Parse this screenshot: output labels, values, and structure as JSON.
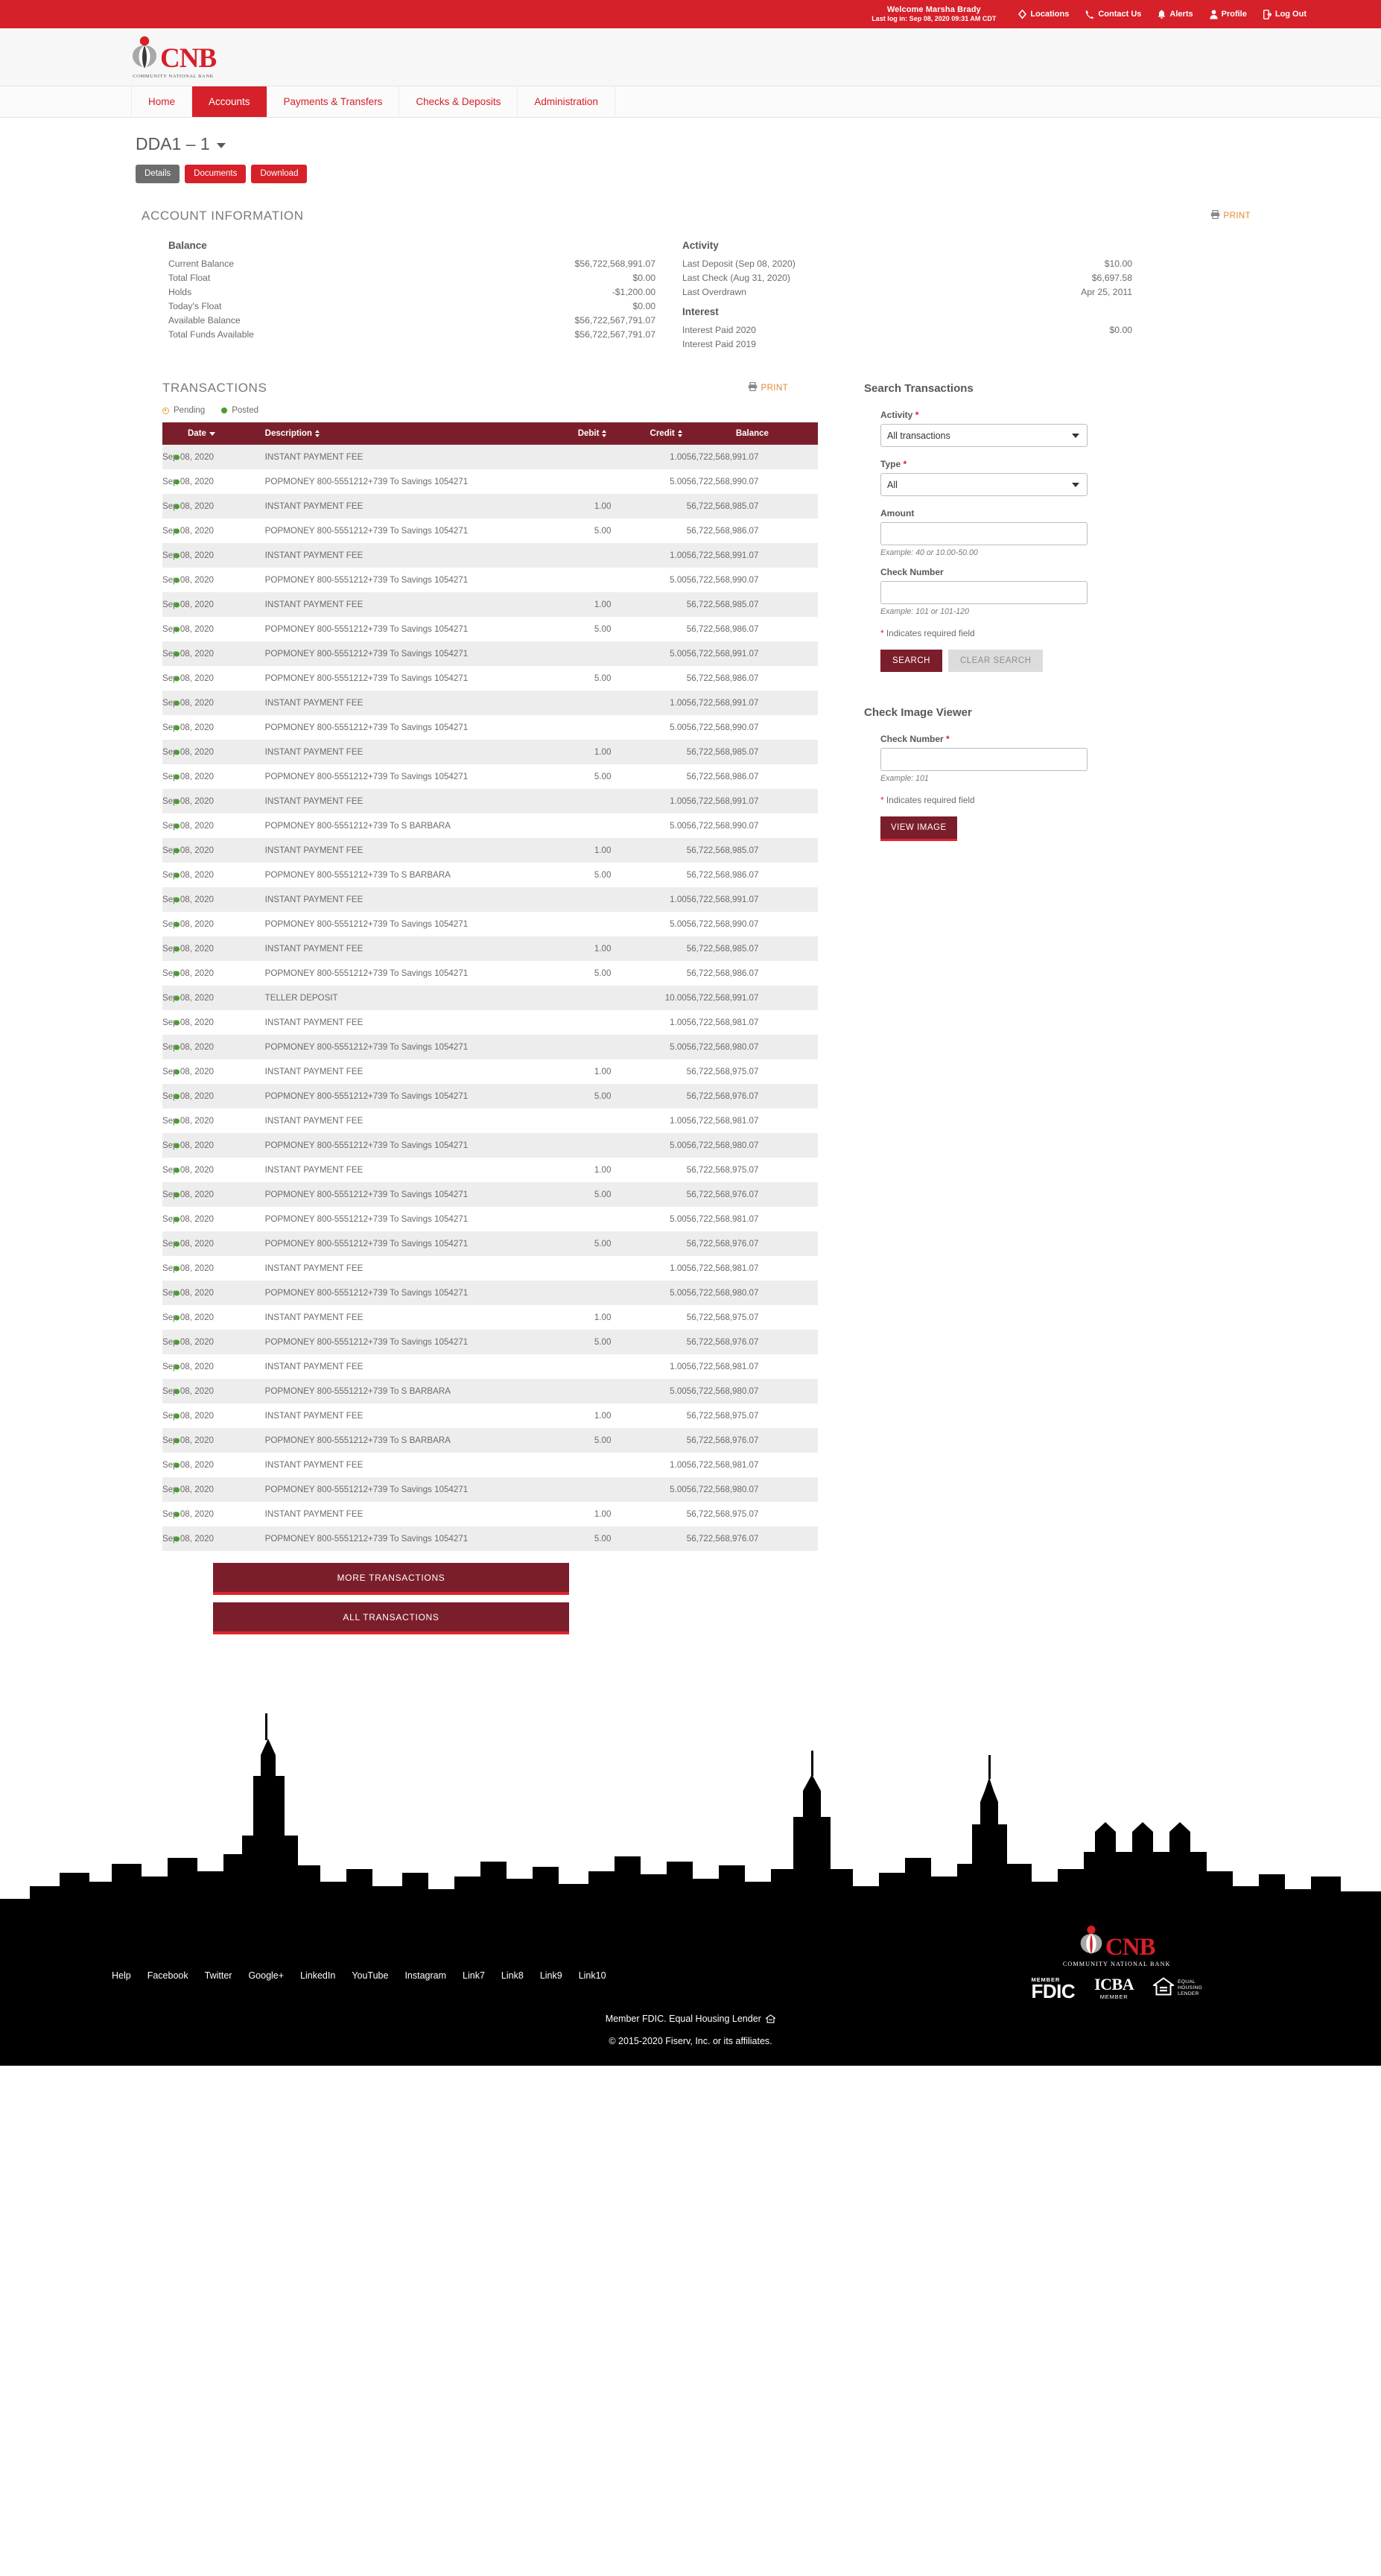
{
  "brand": {
    "logo_text": "CNB",
    "logo_subtitle": "COMMUNITY NATIONAL BANK",
    "accent_red": "#d6202a",
    "dark_red": "#7b1e2b",
    "orange": "#e08a2e",
    "posted_green": "#4a9c2d"
  },
  "utility_bar": {
    "welcome": "Welcome Marsha Brady",
    "last_login": "Last log in: Sep 08, 2020 09:31 AM CDT",
    "links": [
      {
        "label": "Locations",
        "icon": "location-pin-icon"
      },
      {
        "label": "Contact Us",
        "icon": "phone-icon"
      },
      {
        "label": "Alerts",
        "icon": "bell-icon"
      },
      {
        "label": "Profile",
        "icon": "person-icon"
      },
      {
        "label": "Log Out",
        "icon": "logout-icon"
      }
    ]
  },
  "nav": {
    "items": [
      {
        "label": "Home",
        "active": false
      },
      {
        "label": "Accounts",
        "active": true
      },
      {
        "label": "Payments & Transfers",
        "active": false
      },
      {
        "label": "Checks & Deposits",
        "active": false
      },
      {
        "label": "Administration",
        "active": false
      }
    ]
  },
  "account": {
    "title": "DDA1 – 1",
    "buttons": [
      {
        "label": "Details",
        "style": "grey"
      },
      {
        "label": "Documents",
        "style": "red"
      },
      {
        "label": "Download",
        "style": "red"
      }
    ]
  },
  "account_information": {
    "heading": "ACCOUNT INFORMATION",
    "print_label": "PRINT",
    "balance": {
      "heading": "Balance",
      "rows": [
        {
          "label": "Current Balance",
          "value": "$56,722,568,991.07"
        },
        {
          "label": "Total Float",
          "value": "$0.00"
        },
        {
          "label": "Holds",
          "value": "-$1,200.00"
        },
        {
          "label": "Today's Float",
          "value": "$0.00"
        },
        {
          "label": "Available Balance",
          "value": "$56,722,567,791.07"
        },
        {
          "label": "Total Funds Available",
          "value": "$56,722,567,791.07"
        }
      ]
    },
    "activity": {
      "heading": "Activity",
      "rows": [
        {
          "label": "Last Deposit (Sep 08, 2020)",
          "value": "$10.00"
        },
        {
          "label": "Last Check (Aug 31, 2020)",
          "value": "$6,697.58"
        },
        {
          "label": "Last Overdrawn",
          "value": "Apr 25, 2011"
        }
      ]
    },
    "interest": {
      "heading": "Interest",
      "rows": [
        {
          "label": "Interest Paid 2020",
          "value": "$0.00"
        },
        {
          "label": "Interest Paid 2019",
          "value": ""
        }
      ]
    }
  },
  "transactions": {
    "heading": "TRANSACTIONS",
    "print_label": "PRINT",
    "legend": [
      {
        "label": "Pending",
        "icon": "pending-clock-icon"
      },
      {
        "label": "Posted",
        "icon": "posted-dot-icon"
      }
    ],
    "columns": [
      {
        "key": "date",
        "label": "Date",
        "sort": "desc"
      },
      {
        "key": "description",
        "label": "Description",
        "sort": "both"
      },
      {
        "key": "debit",
        "label": "Debit",
        "sort": "both"
      },
      {
        "key": "credit",
        "label": "Credit",
        "sort": "both"
      },
      {
        "key": "balance",
        "label": "Balance",
        "sort": "none"
      }
    ],
    "rows": [
      {
        "status": "posted",
        "date": "Sep 08, 2020",
        "description": "INSTANT PAYMENT FEE",
        "debit": "",
        "credit": "1.00",
        "balance": "56,722,568,991.07"
      },
      {
        "status": "posted",
        "date": "Sep 08, 2020",
        "description": "POPMONEY 800-5551212+739 To Savings 1054271",
        "debit": "",
        "credit": "5.00",
        "balance": "56,722,568,990.07"
      },
      {
        "status": "posted",
        "date": "Sep 08, 2020",
        "description": "INSTANT PAYMENT FEE",
        "debit": "1.00",
        "credit": "",
        "balance": "56,722,568,985.07"
      },
      {
        "status": "posted",
        "date": "Sep 08, 2020",
        "description": "POPMONEY 800-5551212+739 To Savings 1054271",
        "debit": "5.00",
        "credit": "",
        "balance": "56,722,568,986.07"
      },
      {
        "status": "posted",
        "date": "Sep 08, 2020",
        "description": "INSTANT PAYMENT FEE",
        "debit": "",
        "credit": "1.00",
        "balance": "56,722,568,991.07"
      },
      {
        "status": "posted",
        "date": "Sep 08, 2020",
        "description": "POPMONEY 800-5551212+739 To Savings 1054271",
        "debit": "",
        "credit": "5.00",
        "balance": "56,722,568,990.07"
      },
      {
        "status": "posted",
        "date": "Sep 08, 2020",
        "description": "INSTANT PAYMENT FEE",
        "debit": "1.00",
        "credit": "",
        "balance": "56,722,568,985.07"
      },
      {
        "status": "posted",
        "date": "Sep 08, 2020",
        "description": "POPMONEY 800-5551212+739 To Savings 1054271",
        "debit": "5.00",
        "credit": "",
        "balance": "56,722,568,986.07"
      },
      {
        "status": "posted",
        "date": "Sep 08, 2020",
        "description": "POPMONEY 800-5551212+739 To Savings 1054271",
        "debit": "",
        "credit": "5.00",
        "balance": "56,722,568,991.07"
      },
      {
        "status": "posted",
        "date": "Sep 08, 2020",
        "description": "POPMONEY 800-5551212+739 To Savings 1054271",
        "debit": "5.00",
        "credit": "",
        "balance": "56,722,568,986.07"
      },
      {
        "status": "posted",
        "date": "Sep 08, 2020",
        "description": "INSTANT PAYMENT FEE",
        "debit": "",
        "credit": "1.00",
        "balance": "56,722,568,991.07"
      },
      {
        "status": "posted",
        "date": "Sep 08, 2020",
        "description": "POPMONEY 800-5551212+739 To Savings 1054271",
        "debit": "",
        "credit": "5.00",
        "balance": "56,722,568,990.07"
      },
      {
        "status": "posted",
        "date": "Sep 08, 2020",
        "description": "INSTANT PAYMENT FEE",
        "debit": "1.00",
        "credit": "",
        "balance": "56,722,568,985.07"
      },
      {
        "status": "posted",
        "date": "Sep 08, 2020",
        "description": "POPMONEY 800-5551212+739 To Savings 1054271",
        "debit": "5.00",
        "credit": "",
        "balance": "56,722,568,986.07"
      },
      {
        "status": "posted",
        "date": "Sep 08, 2020",
        "description": "INSTANT PAYMENT FEE",
        "debit": "",
        "credit": "1.00",
        "balance": "56,722,568,991.07"
      },
      {
        "status": "posted",
        "date": "Sep 08, 2020",
        "description": "POPMONEY 800-5551212+739 To S BARBARA",
        "debit": "",
        "credit": "5.00",
        "balance": "56,722,568,990.07"
      },
      {
        "status": "posted",
        "date": "Sep 08, 2020",
        "description": "INSTANT PAYMENT FEE",
        "debit": "1.00",
        "credit": "",
        "balance": "56,722,568,985.07"
      },
      {
        "status": "posted",
        "date": "Sep 08, 2020",
        "description": "POPMONEY 800-5551212+739 To S BARBARA",
        "debit": "5.00",
        "credit": "",
        "balance": "56,722,568,986.07"
      },
      {
        "status": "posted",
        "date": "Sep 08, 2020",
        "description": "INSTANT PAYMENT FEE",
        "debit": "",
        "credit": "1.00",
        "balance": "56,722,568,991.07"
      },
      {
        "status": "posted",
        "date": "Sep 08, 2020",
        "description": "POPMONEY 800-5551212+739 To Savings 1054271",
        "debit": "",
        "credit": "5.00",
        "balance": "56,722,568,990.07"
      },
      {
        "status": "posted",
        "date": "Sep 08, 2020",
        "description": "INSTANT PAYMENT FEE",
        "debit": "1.00",
        "credit": "",
        "balance": "56,722,568,985.07"
      },
      {
        "status": "posted",
        "date": "Sep 08, 2020",
        "description": "POPMONEY 800-5551212+739 To Savings 1054271",
        "debit": "5.00",
        "credit": "",
        "balance": "56,722,568,986.07"
      },
      {
        "status": "posted",
        "date": "Sep 08, 2020",
        "description": "TELLER DEPOSIT",
        "debit": "",
        "credit": "10.00",
        "balance": "56,722,568,991.07"
      },
      {
        "status": "posted",
        "date": "Sep 08, 2020",
        "description": "INSTANT PAYMENT FEE",
        "debit": "",
        "credit": "1.00",
        "balance": "56,722,568,981.07"
      },
      {
        "status": "posted",
        "date": "Sep 08, 2020",
        "description": "POPMONEY 800-5551212+739 To Savings 1054271",
        "debit": "",
        "credit": "5.00",
        "balance": "56,722,568,980.07"
      },
      {
        "status": "posted",
        "date": "Sep 08, 2020",
        "description": "INSTANT PAYMENT FEE",
        "debit": "1.00",
        "credit": "",
        "balance": "56,722,568,975.07"
      },
      {
        "status": "posted",
        "date": "Sep 08, 2020",
        "description": "POPMONEY 800-5551212+739 To Savings 1054271",
        "debit": "5.00",
        "credit": "",
        "balance": "56,722,568,976.07"
      },
      {
        "status": "posted",
        "date": "Sep 08, 2020",
        "description": "INSTANT PAYMENT FEE",
        "debit": "",
        "credit": "1.00",
        "balance": "56,722,568,981.07"
      },
      {
        "status": "posted",
        "date": "Sep 08, 2020",
        "description": "POPMONEY 800-5551212+739 To Savings 1054271",
        "debit": "",
        "credit": "5.00",
        "balance": "56,722,568,980.07"
      },
      {
        "status": "posted",
        "date": "Sep 08, 2020",
        "description": "INSTANT PAYMENT FEE",
        "debit": "1.00",
        "credit": "",
        "balance": "56,722,568,975.07"
      },
      {
        "status": "posted",
        "date": "Sep 08, 2020",
        "description": "POPMONEY 800-5551212+739 To Savings 1054271",
        "debit": "5.00",
        "credit": "",
        "balance": "56,722,568,976.07"
      },
      {
        "status": "posted",
        "date": "Sep 08, 2020",
        "description": "POPMONEY 800-5551212+739 To Savings 1054271",
        "debit": "",
        "credit": "5.00",
        "balance": "56,722,568,981.07"
      },
      {
        "status": "posted",
        "date": "Sep 08, 2020",
        "description": "POPMONEY 800-5551212+739 To Savings 1054271",
        "debit": "5.00",
        "credit": "",
        "balance": "56,722,568,976.07"
      },
      {
        "status": "posted",
        "date": "Sep 08, 2020",
        "description": "INSTANT PAYMENT FEE",
        "debit": "",
        "credit": "1.00",
        "balance": "56,722,568,981.07"
      },
      {
        "status": "posted",
        "date": "Sep 08, 2020",
        "description": "POPMONEY 800-5551212+739 To Savings 1054271",
        "debit": "",
        "credit": "5.00",
        "balance": "56,722,568,980.07"
      },
      {
        "status": "posted",
        "date": "Sep 08, 2020",
        "description": "INSTANT PAYMENT FEE",
        "debit": "1.00",
        "credit": "",
        "balance": "56,722,568,975.07"
      },
      {
        "status": "posted",
        "date": "Sep 08, 2020",
        "description": "POPMONEY 800-5551212+739 To Savings 1054271",
        "debit": "5.00",
        "credit": "",
        "balance": "56,722,568,976.07"
      },
      {
        "status": "posted",
        "date": "Sep 08, 2020",
        "description": "INSTANT PAYMENT FEE",
        "debit": "",
        "credit": "1.00",
        "balance": "56,722,568,981.07"
      },
      {
        "status": "posted",
        "date": "Sep 08, 2020",
        "description": "POPMONEY 800-5551212+739 To S BARBARA",
        "debit": "",
        "credit": "5.00",
        "balance": "56,722,568,980.07"
      },
      {
        "status": "posted",
        "date": "Sep 08, 2020",
        "description": "INSTANT PAYMENT FEE",
        "debit": "1.00",
        "credit": "",
        "balance": "56,722,568,975.07"
      },
      {
        "status": "posted",
        "date": "Sep 08, 2020",
        "description": "POPMONEY 800-5551212+739 To S BARBARA",
        "debit": "5.00",
        "credit": "",
        "balance": "56,722,568,976.07"
      },
      {
        "status": "posted",
        "date": "Sep 08, 2020",
        "description": "INSTANT PAYMENT FEE",
        "debit": "",
        "credit": "1.00",
        "balance": "56,722,568,981.07"
      },
      {
        "status": "posted",
        "date": "Sep 08, 2020",
        "description": "POPMONEY 800-5551212+739 To Savings 1054271",
        "debit": "",
        "credit": "5.00",
        "balance": "56,722,568,980.07"
      },
      {
        "status": "posted",
        "date": "Sep 08, 2020",
        "description": "INSTANT PAYMENT FEE",
        "debit": "1.00",
        "credit": "",
        "balance": "56,722,568,975.07"
      },
      {
        "status": "posted",
        "date": "Sep 08, 2020",
        "description": "POPMONEY 800-5551212+739 To Savings 1054271",
        "debit": "5.00",
        "credit": "",
        "balance": "56,722,568,976.07"
      }
    ],
    "more_button": "MORE TRANSACTIONS",
    "all_button": "ALL TRANSACTIONS"
  },
  "search_panel": {
    "title": "Search Transactions",
    "activity_label": "Activity",
    "activity_value": "All transactions",
    "activity_options": [
      "All transactions"
    ],
    "type_label": "Type",
    "type_value": "All",
    "type_options": [
      "All"
    ],
    "amount_label": "Amount",
    "amount_value": "",
    "amount_hint": "Example: 40 or 10.00-50.00",
    "check_number_label": "Check Number",
    "check_number_value": "",
    "check_number_hint": "Example: 101 or 101-120",
    "required_note": "Indicates required field",
    "search_button": "SEARCH",
    "clear_button": "CLEAR SEARCH"
  },
  "check_viewer": {
    "title": "Check Image Viewer",
    "check_number_label": "Check Number",
    "check_number_value": "",
    "check_number_hint": "Example: 101",
    "required_note": "Indicates required field",
    "view_button": "VIEW IMAGE"
  },
  "footer": {
    "links": [
      "Help",
      "Facebook",
      "Twitter",
      "Google+",
      "LinkedIn",
      "YouTube",
      "Instagram",
      "Link7",
      "Link8",
      "Link9",
      "Link10"
    ],
    "badges": {
      "fdic_member": "MEMBER",
      "fdic_name": "FDIC",
      "icba_name": "ICBA",
      "icba_member": "MEMBER",
      "ehl_line1": "EQUAL",
      "ehl_line2": "HOUSING",
      "ehl_line3": "LENDER"
    },
    "member_line": "Member FDIC. Equal Housing Lender",
    "copyright": "© 2015-2020 Fiserv, Inc. or its affiliates."
  }
}
